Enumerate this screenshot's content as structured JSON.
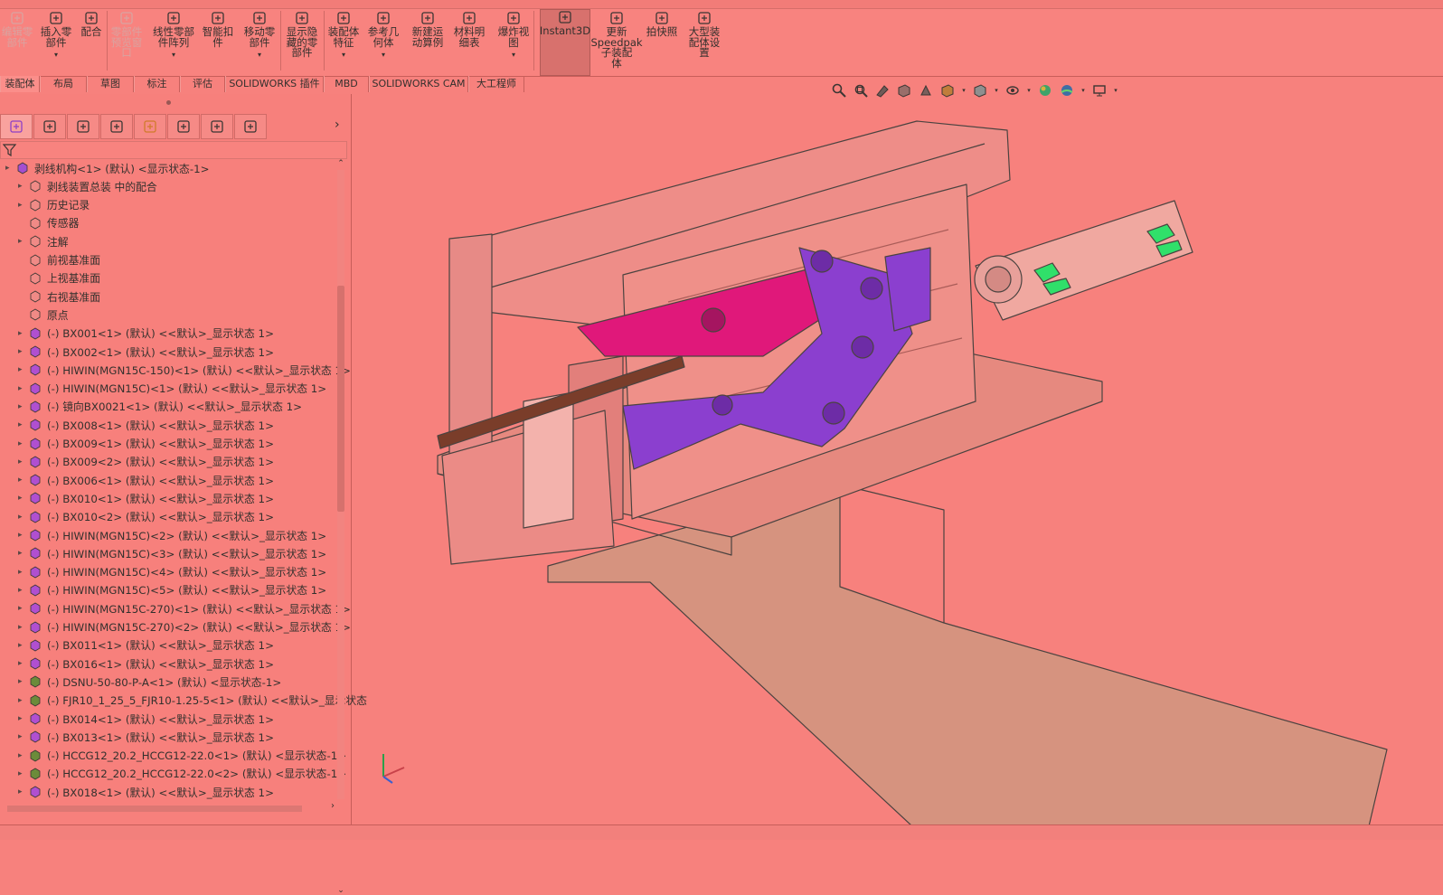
{
  "ribbon": {
    "buttons": [
      {
        "label": "编辑零\n部件",
        "icon": "edit-component-icon",
        "disabled": true,
        "dropdown": false
      },
      {
        "label": "插入零\n部件",
        "icon": "insert-component-icon",
        "disabled": false,
        "dropdown": true
      },
      {
        "label": "配合",
        "icon": "mate-icon",
        "disabled": false,
        "dropdown": false
      },
      {
        "label": "零部件\n预览窗\n口",
        "icon": "component-preview-icon",
        "disabled": true,
        "dropdown": false
      },
      {
        "label": "线性零部\n件阵列",
        "icon": "linear-pattern-icon",
        "disabled": false,
        "dropdown": true
      },
      {
        "label": "智能扣\n件",
        "icon": "smart-fasteners-icon",
        "disabled": false,
        "dropdown": false
      },
      {
        "label": "移动零\n部件",
        "icon": "move-component-icon",
        "disabled": false,
        "dropdown": true
      },
      {
        "label": "显示隐\n藏的零\n部件",
        "icon": "show-hidden-icon",
        "disabled": false,
        "dropdown": false
      },
      {
        "label": "装配体\n特征",
        "icon": "assembly-features-icon",
        "disabled": false,
        "dropdown": true
      },
      {
        "label": "参考几\n何体",
        "icon": "reference-geometry-icon",
        "disabled": false,
        "dropdown": true
      },
      {
        "label": "新建运\n动算例",
        "icon": "new-motion-study-icon",
        "disabled": false,
        "dropdown": false
      },
      {
        "label": "材料明\n细表",
        "icon": "bom-icon",
        "disabled": false,
        "dropdown": false
      },
      {
        "label": "爆炸视\n图",
        "icon": "exploded-view-icon",
        "disabled": false,
        "dropdown": true
      },
      {
        "label": "Instant3D",
        "icon": "instant3d-icon",
        "disabled": false,
        "dropdown": false,
        "active": true
      },
      {
        "label": "更新\nSpeedpak\n子装配\n体",
        "icon": "speedpak-icon",
        "disabled": false,
        "dropdown": false
      },
      {
        "label": "拍快照",
        "icon": "snapshot-icon",
        "disabled": false,
        "dropdown": false
      },
      {
        "label": "大型装\n配体设\n置",
        "icon": "large-assembly-icon",
        "disabled": false,
        "dropdown": false
      }
    ]
  },
  "tabs": [
    "装配体",
    "布局",
    "草图",
    "标注",
    "评估",
    "SOLIDWORKS 插件",
    "MBD",
    "SOLIDWORKS CAM",
    "大工程师"
  ],
  "tree": {
    "root": "剥线机构<1> (默认) <显示状态-1>",
    "fixed_items": [
      {
        "label": "剥线装置总装 中的配合",
        "icon": "mates-folder-icon",
        "expandable": true
      },
      {
        "label": "历史记录",
        "icon": "history-icon",
        "expandable": true
      },
      {
        "label": "传感器",
        "icon": "sensor-icon",
        "expandable": false
      },
      {
        "label": "注解",
        "icon": "annotations-icon",
        "expandable": true
      },
      {
        "label": "前视基准面",
        "icon": "plane-icon",
        "expandable": false
      },
      {
        "label": "上视基准面",
        "icon": "plane-icon",
        "expandable": false
      },
      {
        "label": "右视基准面",
        "icon": "plane-icon",
        "expandable": false
      },
      {
        "label": "原点",
        "icon": "origin-icon",
        "expandable": false
      }
    ],
    "components": [
      {
        "label": "(-) BX001<1> (默认) <<默认>_显示状态 1>",
        "kind": "part"
      },
      {
        "label": "(-) BX002<1> (默认) <<默认>_显示状态 1>",
        "kind": "part"
      },
      {
        "label": "(-) HIWIN(MGN15C-150)<1> (默认) <<默认>_显示状态 1>",
        "kind": "part"
      },
      {
        "label": "(-) HIWIN(MGN15C)<1> (默认) <<默认>_显示状态 1>",
        "kind": "part"
      },
      {
        "label": "(-) 镜向BX0021<1> (默认) <<默认>_显示状态 1>",
        "kind": "part"
      },
      {
        "label": "(-) BX008<1> (默认) <<默认>_显示状态 1>",
        "kind": "part"
      },
      {
        "label": "(-) BX009<1> (默认) <<默认>_显示状态 1>",
        "kind": "part"
      },
      {
        "label": "(-) BX009<2> (默认) <<默认>_显示状态 1>",
        "kind": "part"
      },
      {
        "label": "(-) BX006<1> (默认) <<默认>_显示状态 1>",
        "kind": "part"
      },
      {
        "label": "(-) BX010<1> (默认) <<默认>_显示状态 1>",
        "kind": "part"
      },
      {
        "label": "(-) BX010<2> (默认) <<默认>_显示状态 1>",
        "kind": "part"
      },
      {
        "label": "(-) HIWIN(MGN15C)<2> (默认) <<默认>_显示状态 1>",
        "kind": "part"
      },
      {
        "label": "(-) HIWIN(MGN15C)<3> (默认) <<默认>_显示状态 1>",
        "kind": "part"
      },
      {
        "label": "(-) HIWIN(MGN15C)<4> (默认) <<默认>_显示状态 1>",
        "kind": "part"
      },
      {
        "label": "(-) HIWIN(MGN15C)<5> (默认) <<默认>_显示状态 1>",
        "kind": "part"
      },
      {
        "label": "(-) HIWIN(MGN15C-270)<1> (默认) <<默认>_显示状态 1>",
        "kind": "part"
      },
      {
        "label": "(-) HIWIN(MGN15C-270)<2> (默认) <<默认>_显示状态 1>",
        "kind": "part"
      },
      {
        "label": "(-) BX011<1> (默认) <<默认>_显示状态 1>",
        "kind": "part"
      },
      {
        "label": "(-) BX016<1> (默认) <<默认>_显示状态 1>",
        "kind": "part"
      },
      {
        "label": "(-) DSNU-50-80-P-A<1> (默认) <显示状态-1>",
        "kind": "assembly"
      },
      {
        "label": "(-) FJR10_1_25_5_FJR10-1.25-5<1> (默认) <<默认>_显示状态",
        "kind": "assembly"
      },
      {
        "label": "(-) BX014<1> (默认) <<默认>_显示状态 1>",
        "kind": "part"
      },
      {
        "label": "(-) BX013<1> (默认) <<默认>_显示状态 1>",
        "kind": "part"
      },
      {
        "label": "(-) HCCG12_20.2_HCCG12-22.0<1> (默认) <显示状态-1>",
        "kind": "assembly"
      },
      {
        "label": "(-) HCCG12_20.2_HCCG12-22.0<2> (默认) <显示状态-1>",
        "kind": "assembly"
      },
      {
        "label": "(-) BX018<1> (默认) <<默认>_显示状态 1>",
        "kind": "part"
      }
    ]
  },
  "panel_tabs": [
    "featuremanager-icon",
    "propertymanager-icon",
    "configurationmanager-icon",
    "dimxpert-icon",
    "display-manager-icon",
    "cam-feature-icon",
    "cam-operation-icon",
    "cam-tool-icon"
  ],
  "colors": {
    "background": "#f7817d",
    "text": "#33302d",
    "magenta": "#e0187a",
    "purple": "#8b3fcf",
    "green": "#1ee46a"
  }
}
